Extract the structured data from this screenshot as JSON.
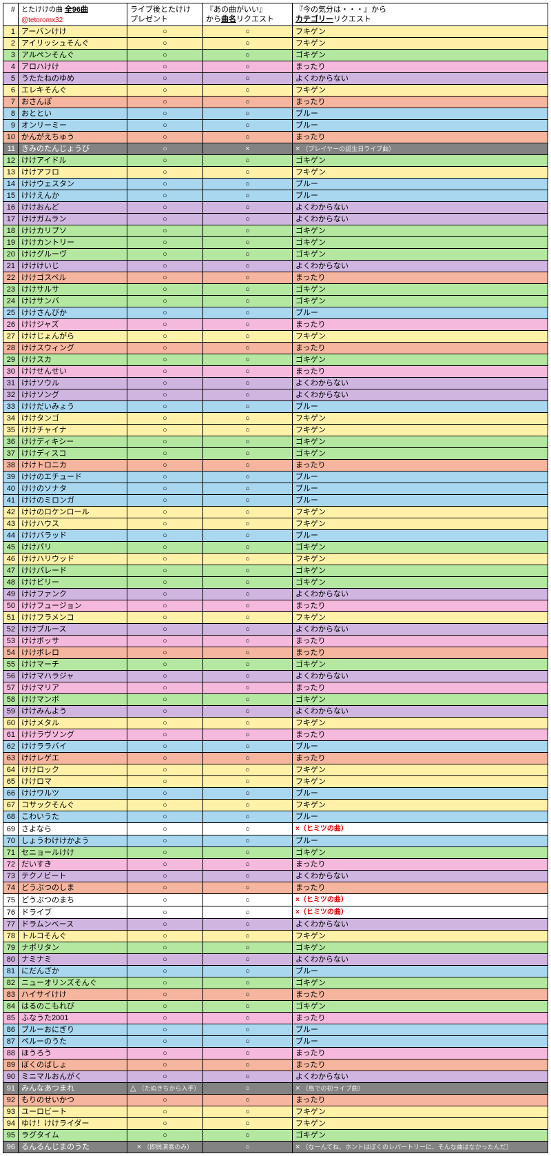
{
  "header": {
    "col0": "#",
    "col1_line1_a": "とたけけの曲 ",
    "col1_line1_b": "全96曲",
    "col1_line2": "@tetoromx32",
    "col2_line1": "ライブ後とたけけ",
    "col2_line2": "プレゼント",
    "col3_line1": "『あの曲がいい』",
    "col3_line2_a": "から",
    "col3_line2_b": "曲名",
    "col3_line2_c": "リクエスト",
    "col4_line1": "『今の気分は・・・』から",
    "col4_line2_a": "カテゴリー",
    "col4_line2_b": "リクエスト"
  },
  "rows": [
    {
      "n": 1,
      "song": "アーバンけけ",
      "c2": "○",
      "c3": "○",
      "c4": "フキゲン",
      "cls": "yellow"
    },
    {
      "n": 2,
      "song": "アイリッシュそんぐ",
      "c2": "○",
      "c3": "○",
      "c4": "フキゲン",
      "cls": "yellow"
    },
    {
      "n": 3,
      "song": "アルペンそんぐ",
      "c2": "○",
      "c3": "○",
      "c4": "ゴキゲン",
      "cls": "green"
    },
    {
      "n": 4,
      "song": "アロハけけ",
      "c2": "○",
      "c3": "○",
      "c4": "まったり",
      "cls": "pink"
    },
    {
      "n": 5,
      "song": "うたたねのゆめ",
      "c2": "○",
      "c3": "○",
      "c4": "よくわからない",
      "cls": "violet"
    },
    {
      "n": 6,
      "song": "エレキそんぐ",
      "c2": "○",
      "c3": "○",
      "c4": "フキゲン",
      "cls": "yellow"
    },
    {
      "n": 7,
      "song": "おさんぽ",
      "c2": "○",
      "c3": "○",
      "c4": "まったり",
      "cls": "peach"
    },
    {
      "n": 8,
      "song": "おととい",
      "c2": "○",
      "c3": "○",
      "c4": "ブルー",
      "cls": "blue"
    },
    {
      "n": 9,
      "song": "オンリーミー",
      "c2": "○",
      "c3": "○",
      "c4": "ブルー",
      "cls": "blue"
    },
    {
      "n": 10,
      "song": "かんがえちゅう",
      "c2": "○",
      "c3": "○",
      "c4": "まったり",
      "cls": "peach"
    },
    {
      "n": 11,
      "song": "きみのたんじょうび",
      "c2": "○",
      "c3": "×",
      "c4": "× ",
      "note4": "（プレイヤーの誕生日ライブ曲）",
      "cls": "gray"
    },
    {
      "n": 12,
      "song": "けけアイドル",
      "c2": "○",
      "c3": "○",
      "c4": "ゴキゲン",
      "cls": "green"
    },
    {
      "n": 13,
      "song": "けけアフロ",
      "c2": "○",
      "c3": "○",
      "c4": "フキゲン",
      "cls": "yellow"
    },
    {
      "n": 14,
      "song": "けけウェスタン",
      "c2": "○",
      "c3": "○",
      "c4": "ブルー",
      "cls": "blue"
    },
    {
      "n": 15,
      "song": "けけえんか",
      "c2": "○",
      "c3": "○",
      "c4": "ブルー",
      "cls": "blue"
    },
    {
      "n": 16,
      "song": "けけおんど",
      "c2": "○",
      "c3": "○",
      "c4": "よくわからない",
      "cls": "violet"
    },
    {
      "n": 17,
      "song": "けけガムラン",
      "c2": "○",
      "c3": "○",
      "c4": "よくわからない",
      "cls": "violet"
    },
    {
      "n": 18,
      "song": "けけカリプソ",
      "c2": "○",
      "c3": "○",
      "c4": "ゴキゲン",
      "cls": "green"
    },
    {
      "n": 19,
      "song": "けけカントリー",
      "c2": "○",
      "c3": "○",
      "c4": "ゴキゲン",
      "cls": "green"
    },
    {
      "n": 20,
      "song": "けけグルーヴ",
      "c2": "○",
      "c3": "○",
      "c4": "ゴキゲン",
      "cls": "green"
    },
    {
      "n": 21,
      "song": "けけけいじ",
      "c2": "○",
      "c3": "○",
      "c4": "よくわからない",
      "cls": "violet"
    },
    {
      "n": 22,
      "song": "けけゴスペル",
      "c2": "○",
      "c3": "○",
      "c4": "まったり",
      "cls": "peach"
    },
    {
      "n": 23,
      "song": "けけサルサ",
      "c2": "○",
      "c3": "○",
      "c4": "ゴキゲン",
      "cls": "green"
    },
    {
      "n": 24,
      "song": "けけサンバ",
      "c2": "○",
      "c3": "○",
      "c4": "ゴキゲン",
      "cls": "green"
    },
    {
      "n": 25,
      "song": "けけさんびか",
      "c2": "○",
      "c3": "○",
      "c4": "ブルー",
      "cls": "blue"
    },
    {
      "n": 26,
      "song": "けけジャズ",
      "c2": "○",
      "c3": "○",
      "c4": "まったり",
      "cls": "pink"
    },
    {
      "n": 27,
      "song": "けけじょんがら",
      "c2": "○",
      "c3": "○",
      "c4": "フキゲン",
      "cls": "yellow"
    },
    {
      "n": 28,
      "song": "けけスウィング",
      "c2": "○",
      "c3": "○",
      "c4": "まったり",
      "cls": "peach"
    },
    {
      "n": 29,
      "song": "けけスカ",
      "c2": "○",
      "c3": "○",
      "c4": "ゴキゲン",
      "cls": "green"
    },
    {
      "n": 30,
      "song": "けけせんせい",
      "c2": "○",
      "c3": "○",
      "c4": "まったり",
      "cls": "pink"
    },
    {
      "n": 31,
      "song": "けけソウル",
      "c2": "○",
      "c3": "○",
      "c4": "よくわからない",
      "cls": "violet"
    },
    {
      "n": 32,
      "song": "けけソング",
      "c2": "○",
      "c3": "○",
      "c4": "よくわからない",
      "cls": "violet"
    },
    {
      "n": 33,
      "song": "けけだいみょう",
      "c2": "○",
      "c3": "○",
      "c4": "ブルー",
      "cls": "blue"
    },
    {
      "n": 34,
      "song": "けけタンゴ",
      "c2": "○",
      "c3": "○",
      "c4": "フキゲン",
      "cls": "yellow"
    },
    {
      "n": 35,
      "song": "けけチャイナ",
      "c2": "○",
      "c3": "○",
      "c4": "フキゲン",
      "cls": "yellow"
    },
    {
      "n": 36,
      "song": "けけディキシー",
      "c2": "○",
      "c3": "○",
      "c4": "ゴキゲン",
      "cls": "green"
    },
    {
      "n": 37,
      "song": "けけディスコ",
      "c2": "○",
      "c3": "○",
      "c4": "ゴキゲン",
      "cls": "green"
    },
    {
      "n": 38,
      "song": "けけトロニカ",
      "c2": "○",
      "c3": "○",
      "c4": "まったり",
      "cls": "peach"
    },
    {
      "n": 39,
      "song": "けけのエチュード",
      "c2": "○",
      "c3": "○",
      "c4": "ブルー",
      "cls": "blue"
    },
    {
      "n": 40,
      "song": "けけのソナタ",
      "c2": "○",
      "c3": "○",
      "c4": "ブルー",
      "cls": "blue"
    },
    {
      "n": 41,
      "song": "けけのミロンガ",
      "c2": "○",
      "c3": "○",
      "c4": "ブルー",
      "cls": "blue"
    },
    {
      "n": 42,
      "song": "けけのロケンロール",
      "c2": "○",
      "c3": "○",
      "c4": "フキゲン",
      "cls": "yellow"
    },
    {
      "n": 43,
      "song": "けけハウス",
      "c2": "○",
      "c3": "○",
      "c4": "フキゲン",
      "cls": "yellow"
    },
    {
      "n": 44,
      "song": "けけバラッド",
      "c2": "○",
      "c3": "○",
      "c4": "ブルー",
      "cls": "blue"
    },
    {
      "n": 45,
      "song": "けけパリ",
      "c2": "○",
      "c3": "○",
      "c4": "ゴキゲン",
      "cls": "green"
    },
    {
      "n": 46,
      "song": "けけハリウッド",
      "c2": "○",
      "c3": "○",
      "c4": "フキゲン",
      "cls": "yellow"
    },
    {
      "n": 47,
      "song": "けけパレード",
      "c2": "○",
      "c3": "○",
      "c4": "ゴキゲン",
      "cls": "green"
    },
    {
      "n": 48,
      "song": "けけビリー",
      "c2": "○",
      "c3": "○",
      "c4": "ゴキゲン",
      "cls": "green"
    },
    {
      "n": 49,
      "song": "けけファンク",
      "c2": "○",
      "c3": "○",
      "c4": "よくわからない",
      "cls": "violet"
    },
    {
      "n": 50,
      "song": "けけフュージョン",
      "c2": "○",
      "c3": "○",
      "c4": "まったり",
      "cls": "pink"
    },
    {
      "n": 51,
      "song": "けけフラメンコ",
      "c2": "○",
      "c3": "○",
      "c4": "フキゲン",
      "cls": "yellow"
    },
    {
      "n": 52,
      "song": "けけブルース",
      "c2": "○",
      "c3": "○",
      "c4": "よくわからない",
      "cls": "violet"
    },
    {
      "n": 53,
      "song": "けけボッサ",
      "c2": "○",
      "c3": "○",
      "c4": "まったり",
      "cls": "pink"
    },
    {
      "n": 54,
      "song": "けけボレロ",
      "c2": "○",
      "c3": "○",
      "c4": "まったり",
      "cls": "peach"
    },
    {
      "n": 55,
      "song": "けけマーチ",
      "c2": "○",
      "c3": "○",
      "c4": "ゴキゲン",
      "cls": "green"
    },
    {
      "n": 56,
      "song": "けけマハラジャ",
      "c2": "○",
      "c3": "○",
      "c4": "よくわからない",
      "cls": "violet"
    },
    {
      "n": 57,
      "song": "けけマリア",
      "c2": "○",
      "c3": "○",
      "c4": "まったり",
      "cls": "pink"
    },
    {
      "n": 58,
      "song": "けけマンボ",
      "c2": "○",
      "c3": "○",
      "c4": "ゴキゲン",
      "cls": "green"
    },
    {
      "n": 59,
      "song": "けけみんよう",
      "c2": "○",
      "c3": "○",
      "c4": "よくわからない",
      "cls": "violet"
    },
    {
      "n": 60,
      "song": "けけメタル",
      "c2": "○",
      "c3": "○",
      "c4": "フキゲン",
      "cls": "yellow"
    },
    {
      "n": 61,
      "song": "けけラヴソング",
      "c2": "○",
      "c3": "○",
      "c4": "まったり",
      "cls": "pink"
    },
    {
      "n": 62,
      "song": "けけララバイ",
      "c2": "○",
      "c3": "○",
      "c4": "ブルー",
      "cls": "blue"
    },
    {
      "n": 63,
      "song": "けけレゲエ",
      "c2": "○",
      "c3": "○",
      "c4": "まったり",
      "cls": "peach"
    },
    {
      "n": 64,
      "song": "けけロック",
      "c2": "○",
      "c3": "○",
      "c4": "フキゲン",
      "cls": "yellow"
    },
    {
      "n": 65,
      "song": "けけロマ",
      "c2": "○",
      "c3": "○",
      "c4": "フキゲン",
      "cls": "yellow"
    },
    {
      "n": 66,
      "song": "けけワルツ",
      "c2": "○",
      "c3": "○",
      "c4": "ブルー",
      "cls": "blue"
    },
    {
      "n": 67,
      "song": "コサックそんぐ",
      "c2": "○",
      "c3": "○",
      "c4": "フキゲン",
      "cls": "yellow"
    },
    {
      "n": 68,
      "song": "こわいうた",
      "c2": "○",
      "c3": "○",
      "c4": "ブルー",
      "cls": "blue"
    },
    {
      "n": 69,
      "song": "さよなら",
      "c2": "○",
      "c3": "○",
      "c4": "",
      "red4": "×（ヒミツの曲）",
      "cls": "white"
    },
    {
      "n": 70,
      "song": "しょうわけけかよう",
      "c2": "○",
      "c3": "○",
      "c4": "ブルー",
      "cls": "blue"
    },
    {
      "n": 71,
      "song": "セニョールけけ",
      "c2": "○",
      "c3": "○",
      "c4": "ゴキゲン",
      "cls": "green"
    },
    {
      "n": 72,
      "song": "だいすき",
      "c2": "○",
      "c3": "○",
      "c4": "まったり",
      "cls": "pink"
    },
    {
      "n": 73,
      "song": "テクノビート",
      "c2": "○",
      "c3": "○",
      "c4": "よくわからない",
      "cls": "violet"
    },
    {
      "n": 74,
      "song": "どうぶつのしま",
      "c2": "○",
      "c3": "○",
      "c4": "まったり",
      "cls": "peach"
    },
    {
      "n": 75,
      "song": "どうぶつのまち",
      "c2": "○",
      "c3": "○",
      "c4": "",
      "red4": "×（ヒミツの曲）",
      "cls": "white"
    },
    {
      "n": 76,
      "song": "ドライブ",
      "c2": "○",
      "c3": "○",
      "c4": "",
      "red4": "×（ヒミツの曲）",
      "cls": "white"
    },
    {
      "n": 77,
      "song": "ドラムンベース",
      "c2": "○",
      "c3": "○",
      "c4": "よくわからない",
      "cls": "violet"
    },
    {
      "n": 78,
      "song": "トルコそんぐ",
      "c2": "○",
      "c3": "○",
      "c4": "フキゲン",
      "cls": "yellow"
    },
    {
      "n": 79,
      "song": "ナポリタン",
      "c2": "○",
      "c3": "○",
      "c4": "ゴキゲン",
      "cls": "green"
    },
    {
      "n": 80,
      "song": "ナミナミ",
      "c2": "○",
      "c3": "○",
      "c4": "よくわからない",
      "cls": "violet"
    },
    {
      "n": 81,
      "song": "にだんざか",
      "c2": "○",
      "c3": "○",
      "c4": "ブルー",
      "cls": "blue"
    },
    {
      "n": 82,
      "song": "ニューオリンズそんぐ",
      "c2": "○",
      "c3": "○",
      "c4": "ゴキゲン",
      "cls": "green"
    },
    {
      "n": 83,
      "song": "ハイサイけけ",
      "c2": "○",
      "c3": "○",
      "c4": "まったり",
      "cls": "peach"
    },
    {
      "n": 84,
      "song": "はるのこもれび",
      "c2": "○",
      "c3": "○",
      "c4": "ゴキゲン",
      "cls": "green"
    },
    {
      "n": 85,
      "song": "ふなうた2001",
      "c2": "○",
      "c3": "○",
      "c4": "まったり",
      "cls": "pink"
    },
    {
      "n": 86,
      "song": "ブルーおにぎり",
      "c2": "○",
      "c3": "○",
      "c4": "ブルー",
      "cls": "blue"
    },
    {
      "n": 87,
      "song": "ペルーのうた",
      "c2": "○",
      "c3": "○",
      "c4": "ブルー",
      "cls": "blue"
    },
    {
      "n": 88,
      "song": "ほうろう",
      "c2": "○",
      "c3": "○",
      "c4": "まったり",
      "cls": "pink"
    },
    {
      "n": 89,
      "song": "ぼくのばしょ",
      "c2": "○",
      "c3": "○",
      "c4": "まったり",
      "cls": "peach"
    },
    {
      "n": 90,
      "song": "ミニマルおんがく",
      "c2": "○",
      "c3": "○",
      "c4": "よくわからない",
      "cls": "violet"
    },
    {
      "n": 91,
      "song": "みんなあつまれ",
      "c2": "△ ",
      "note2": "（たぬきちから入手）",
      "c3": "○",
      "c4": "× ",
      "note4": "（島での初ライブ曲）",
      "cls": "gray"
    },
    {
      "n": 92,
      "song": "もりのせいかつ",
      "c2": "○",
      "c3": "○",
      "c4": "まったり",
      "cls": "peach"
    },
    {
      "n": 93,
      "song": "ユーロビート",
      "c2": "○",
      "c3": "○",
      "c4": "フキゲン",
      "cls": "yellow"
    },
    {
      "n": 94,
      "song": "ゆけ！けけライダー",
      "c2": "○",
      "c3": "○",
      "c4": "フキゲン",
      "cls": "yellow"
    },
    {
      "n": 95,
      "song": "ラグタイム",
      "c2": "○",
      "c3": "○",
      "c4": "ゴキゲン",
      "cls": "green"
    },
    {
      "n": 96,
      "song": "るんるんじまのうた",
      "c2": "× ",
      "note2": "（即興演奏のみ）",
      "c3": "○",
      "c4": "× ",
      "note4": "（なーんてね、ホントはぼくのレパートリーに、そんな曲はなかったんだ）",
      "cls": "gray"
    }
  ]
}
